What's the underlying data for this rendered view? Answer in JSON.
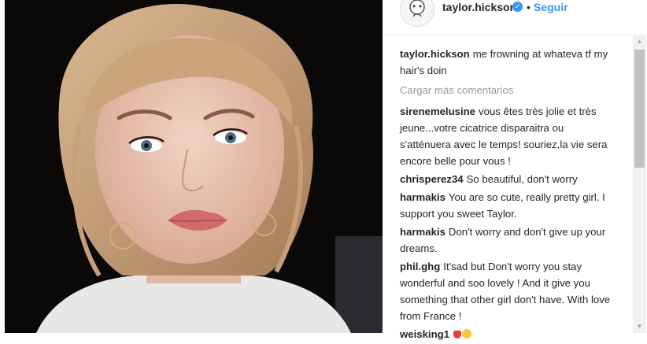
{
  "header": {
    "username": "taylor.hickson",
    "verified_mark": "✓",
    "separator": "•",
    "follow_label": "Seguir",
    "avatar_icon": "avatar-icon"
  },
  "caption": {
    "author": "taylor.hickson",
    "text": "me frowning at whateva tf my hair's doin"
  },
  "load_more_label": "Cargar más comentarios",
  "comments": [
    {
      "author": "sirenemelusine",
      "text": "vous êtes très jolie et très jeune...votre cicatrice disparaitra ou s'atténuera avec le temps! souriez,la vie sera encore belle pour vous !"
    },
    {
      "author": "chrisperez34",
      "text": "So beautiful, don't worry"
    },
    {
      "author": "harmakis",
      "text": "You are so cute, really pretty girl. I support you sweet Taylor."
    },
    {
      "author": "harmakis",
      "text": "Don't worry and don't give up your dreams."
    },
    {
      "author": "phil.ghg",
      "text": "It'sad but Don't worry you stay wonderful and soo lovely ! And it give you something that other girl don't have. With love from France !"
    },
    {
      "author": "weisking1",
      "text": ""
    }
  ],
  "colors": {
    "link_blue": "#3897f0",
    "text": "#262626",
    "muted": "#999999"
  }
}
